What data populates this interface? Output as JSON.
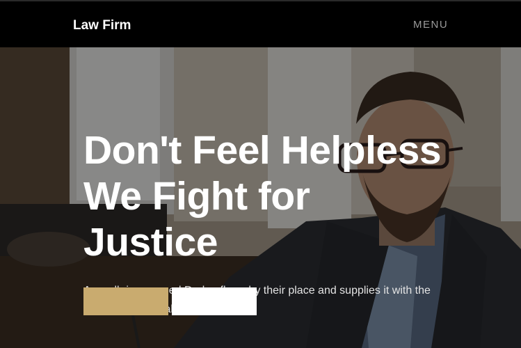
{
  "navbar": {
    "brand": "Law Firm",
    "menu_label": "MENU"
  },
  "hero": {
    "title_lines": [
      "Don't Feel Helpless",
      "We Fight for",
      "Justice"
    ],
    "subtitle": "A small river named Duden flows by their place and supplies it with the necessary regelialia.",
    "primary_button_label": "",
    "secondary_button_label": ""
  },
  "colors": {
    "navbar_bg": "#000000",
    "accent": "#c9ab6f",
    "overlay": "rgba(0,0,0,0.42)"
  }
}
